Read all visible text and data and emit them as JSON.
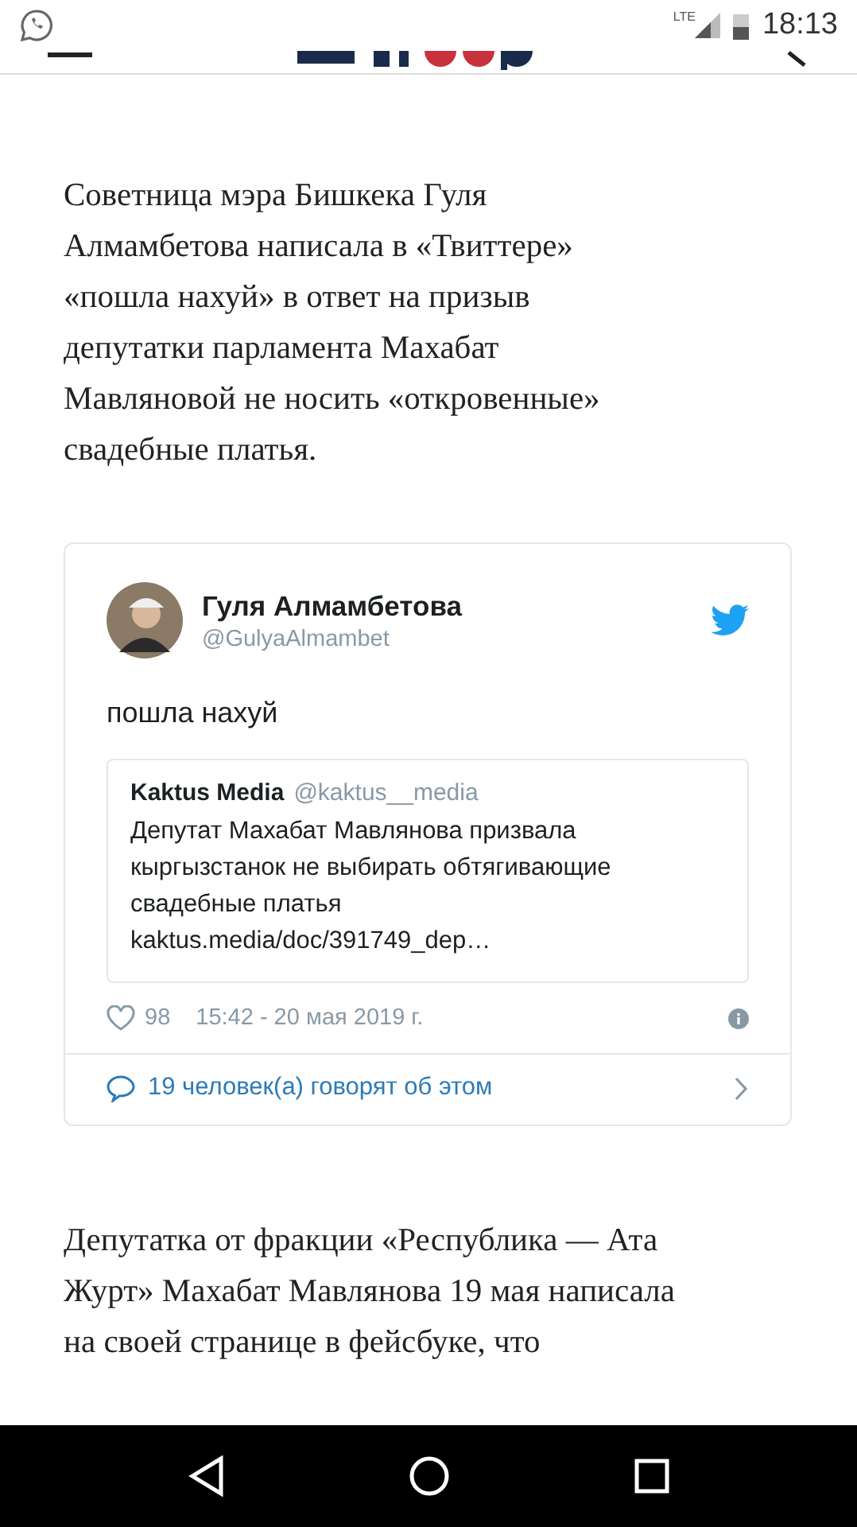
{
  "status_bar": {
    "network_type": "LTE",
    "time": "18:13"
  },
  "intro_paragraph": [
    "Советница мэра Бишкека Гуля",
    "Алмамбетова написала в «Твиттере»",
    "«пошла нахуй» в ответ на призыв",
    "депутатки парламента Махабат",
    "Мавляновой не носить «откровенные»",
    "свадебные платья."
  ],
  "tweet": {
    "author": "Гуля Алмамбетова",
    "handle": "@GulyaAlmambet",
    "text": "пошла нахуй",
    "quoted": {
      "author": "Kaktus Media",
      "handle": "@kaktus__media",
      "lines": [
        "Депутат Махабат Мавлянова призвала",
        "кыргызстанок не выбирать обтягивающие",
        "свадебные платья",
        "kaktus.media/doc/391749_dep…"
      ]
    },
    "likes": "98",
    "timestamp": "15:42 - 20 мая 2019 г.",
    "discussion": "19 человек(а) говорят об этом"
  },
  "second_paragraph": [
    "Депутатка от фракции «Республика — Ата",
    "Журт» Махабат Мавлянова 19 мая написала",
    "на своей странице в фейсбуке, что"
  ]
}
